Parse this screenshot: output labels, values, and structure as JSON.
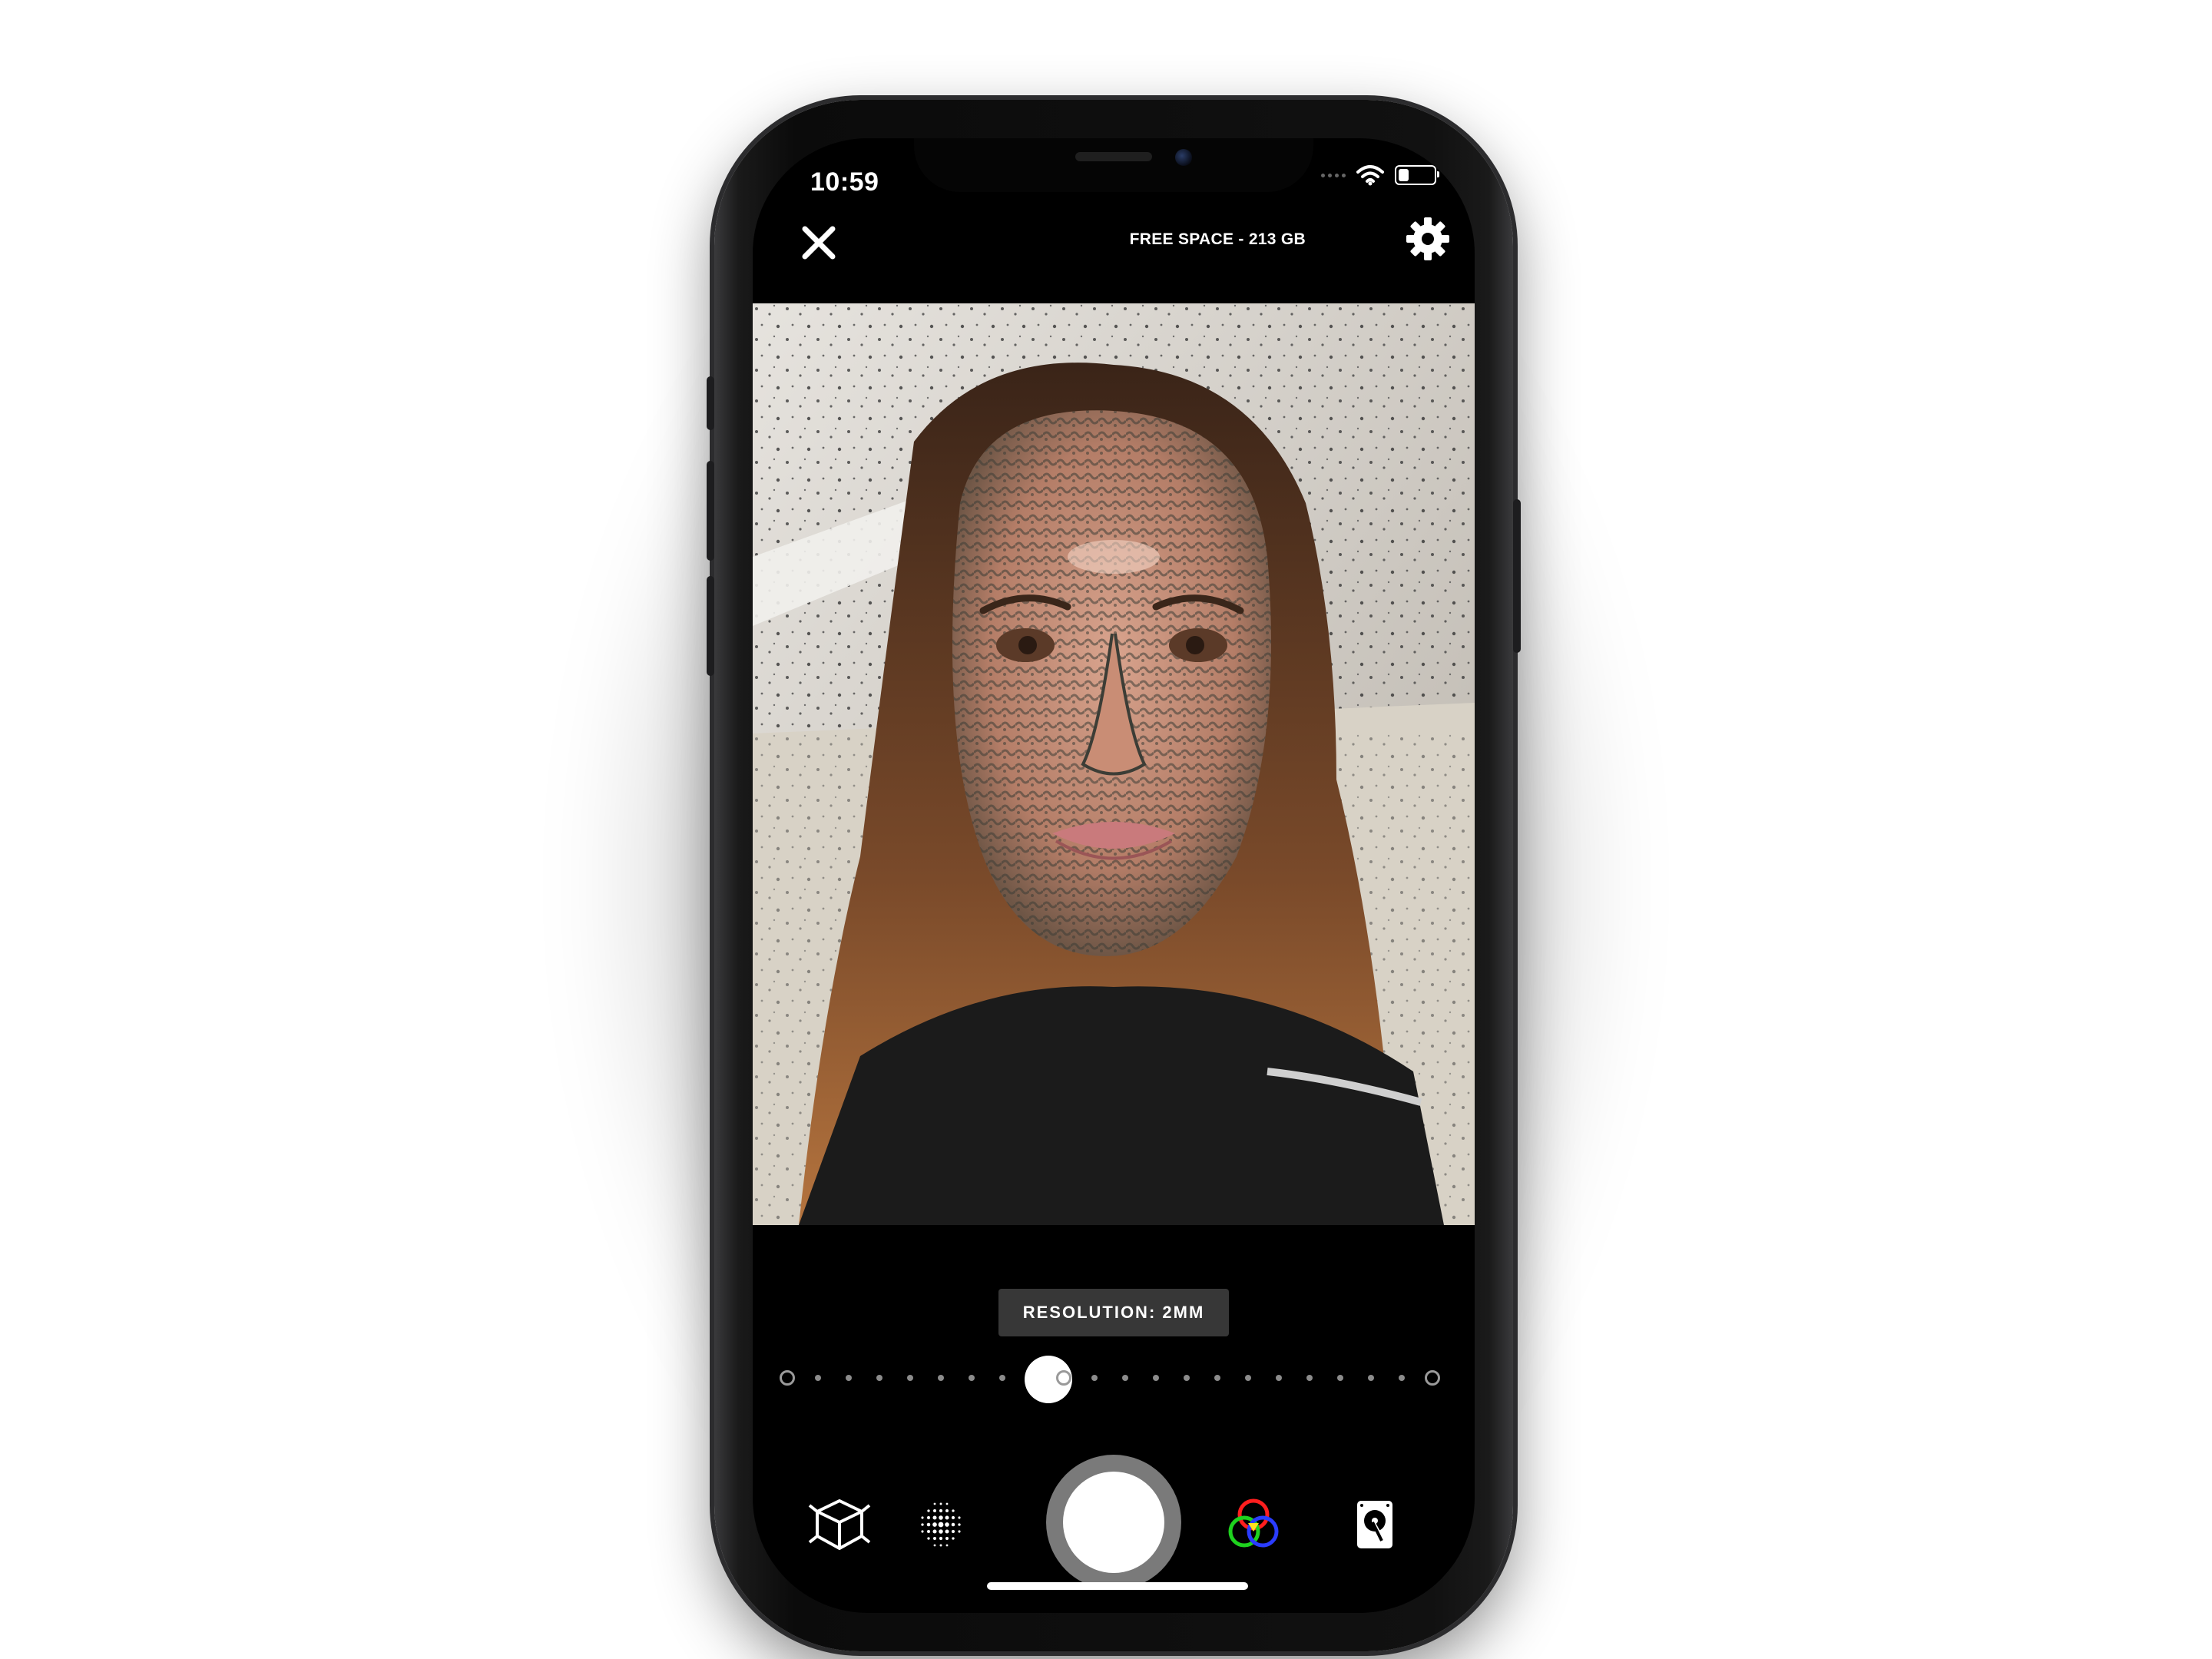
{
  "status_bar": {
    "time": "10:59",
    "battery_level": 0.3
  },
  "header": {
    "free_space": "FREE SPACE - 213 GB",
    "close_icon": "close-icon",
    "settings_icon": "gear-icon"
  },
  "viewfinder": {
    "resolution_label": "RESOLUTION: 2MM"
  },
  "slider": {
    "stops": 22,
    "ring_stops": [
      0,
      9,
      21
    ],
    "selected_index": 8
  },
  "toolbar": {
    "tools": [
      {
        "name": "3d-mesh-icon"
      },
      {
        "name": "point-cloud-icon"
      },
      {
        "name": "shutter-button"
      },
      {
        "name": "rgb-color-icon"
      },
      {
        "name": "storage-drive-icon"
      }
    ]
  },
  "colors": {
    "background": "#000000",
    "text": "#ffffff",
    "pill": "#3c3c3c",
    "shutter_ring": "#7a7a7a"
  }
}
